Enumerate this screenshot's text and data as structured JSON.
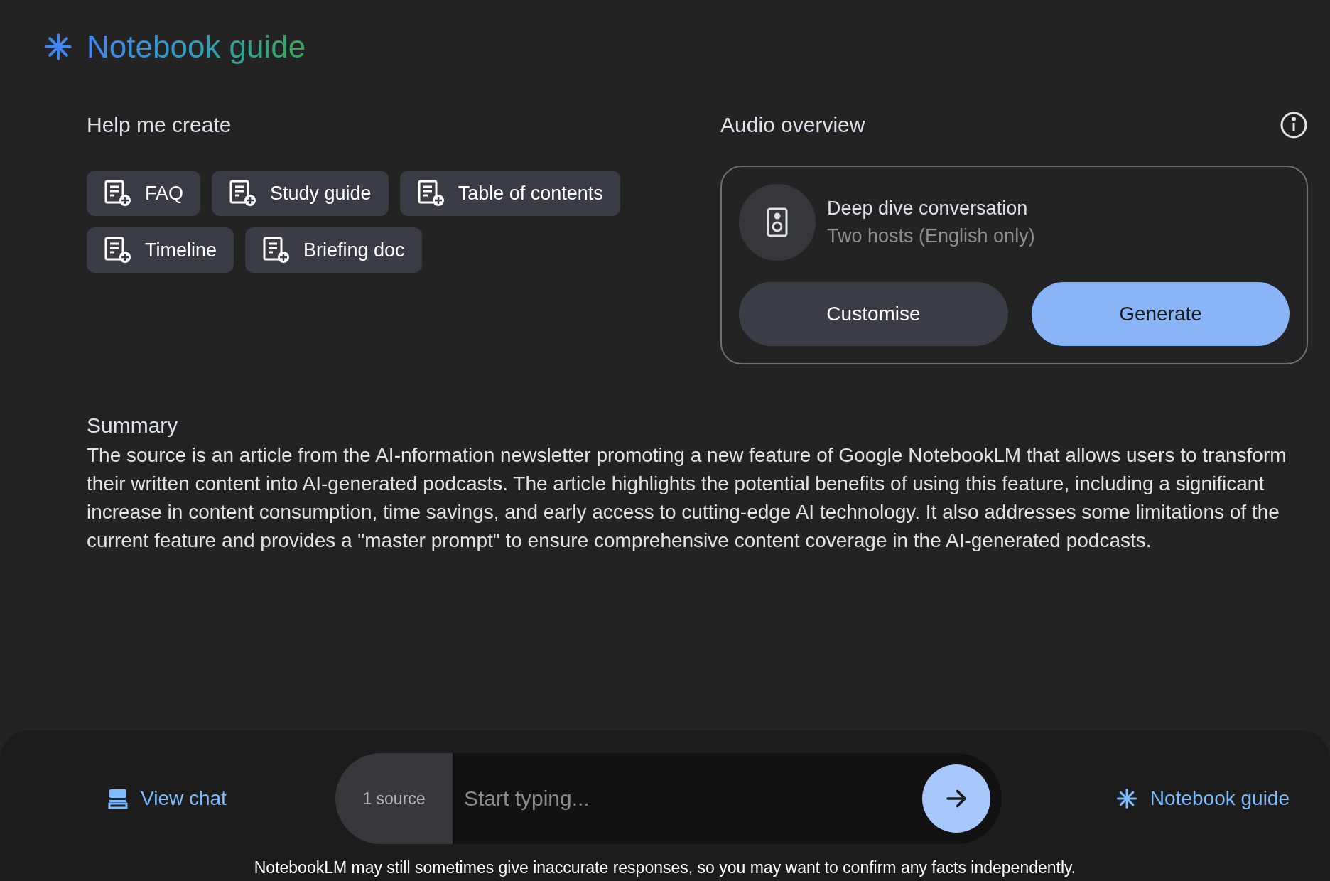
{
  "header": {
    "title": "Notebook guide"
  },
  "help_me_create": {
    "heading": "Help me create",
    "items": [
      {
        "label": "FAQ"
      },
      {
        "label": "Study guide"
      },
      {
        "label": "Table of contents"
      },
      {
        "label": "Timeline"
      },
      {
        "label": "Briefing doc"
      }
    ]
  },
  "audio_overview": {
    "heading": "Audio overview",
    "title": "Deep dive conversation",
    "subtitle": "Two hosts (English only)",
    "buttons": [
      {
        "label": "Customise",
        "kind": "secondary"
      },
      {
        "label": "Generate",
        "kind": "primary"
      }
    ]
  },
  "summary": {
    "heading": "Summary",
    "text": "The source is an article from the AI-nformation newsletter promoting a new feature of Google NotebookLM that allows users to transform their written content into AI-generated podcasts. The article highlights the potential benefits of using this feature, including a significant increase in content consumption, time savings, and early access to cutting-edge AI technology. It also addresses some limitations of the current feature and provides a \"master prompt\" to ensure comprehensive content coverage in the AI-generated podcasts."
  },
  "chat_bar": {
    "view_chat": "View chat",
    "source_count": "1 source",
    "placeholder": "Start typing...",
    "notebook_guide": "Notebook guide"
  },
  "disclaimer": "NotebookLM may still sometimes give inaccurate responses, so you may want to confirm any facts independently."
}
